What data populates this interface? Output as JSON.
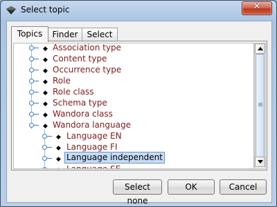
{
  "window": {
    "title": "Select topic"
  },
  "tabs": [
    {
      "label": "Topics",
      "active": true
    },
    {
      "label": "Finder",
      "active": false
    },
    {
      "label": "Select",
      "active": false
    }
  ],
  "tree": {
    "items": [
      {
        "label": "Association type",
        "selected": false
      },
      {
        "label": "Content type",
        "selected": false
      },
      {
        "label": "Occurrence type",
        "selected": false
      },
      {
        "label": "Role",
        "selected": false
      },
      {
        "label": "Role class",
        "selected": false
      },
      {
        "label": "Schema type",
        "selected": false
      },
      {
        "label": "Wandora class",
        "selected": false
      },
      {
        "label": "Wandora language",
        "selected": false
      },
      {
        "label": "Language EN",
        "selected": false
      },
      {
        "label": "Language FI",
        "selected": false
      },
      {
        "label": "Language independent",
        "selected": true
      },
      {
        "label": "Language SE",
        "selected": false
      }
    ]
  },
  "buttons": {
    "select_none": "Select none",
    "ok": "OK",
    "cancel": "Cancel"
  },
  "colors": {
    "tree_label": "#7a1c1c",
    "selection_bg": "#c6dbf5",
    "tree_lines": "#3a7abf"
  }
}
